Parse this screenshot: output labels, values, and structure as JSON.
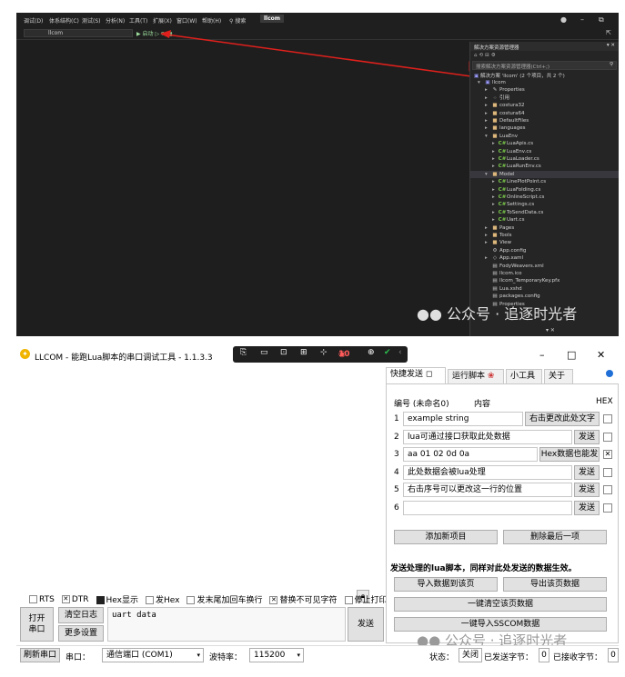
{
  "vs": {
    "menu": [
      "调试(D)",
      "体系结构(C)",
      "测试(S)",
      "分析(N)",
      "工具(T)",
      "扩展(X)",
      "窗口(W)",
      "帮助(H)",
      "搜索",
      "llcom"
    ],
    "search_label": "搜索",
    "project_badge": "llcom",
    "toolbar_combo": "llcom",
    "run_label": "启动",
    "solution_explorer": {
      "title": "解决方案资源管理器",
      "search_placeholder": "搜索解决方案资源管理器(Ctrl+;)",
      "solution_line": "解决方案 'llcom' (2 个项目，共 2 个)",
      "items": [
        {
          "label": "llcom",
          "level": 0,
          "icon": "project-icon",
          "arrow": "▾"
        },
        {
          "label": "Properties",
          "level": 1,
          "icon": "wrench-icon",
          "arrow": "▸"
        },
        {
          "label": "引用",
          "level": 1,
          "icon": "reference-icon",
          "arrow": "▸"
        },
        {
          "label": "costura32",
          "level": 1,
          "icon": "folder-icon",
          "arrow": "▸"
        },
        {
          "label": "costura64",
          "level": 1,
          "icon": "folder-icon",
          "arrow": "▸"
        },
        {
          "label": "DefaultFiles",
          "level": 1,
          "icon": "folder-icon",
          "arrow": "▸"
        },
        {
          "label": "languages",
          "level": 1,
          "icon": "folder-icon",
          "arrow": "▸"
        },
        {
          "label": "LuaEnv",
          "level": 1,
          "icon": "folder-icon",
          "arrow": "▾"
        },
        {
          "label": "LuaApis.cs",
          "level": 2,
          "icon": "cs-icon",
          "arrow": "▸"
        },
        {
          "label": "LuaEnv.cs",
          "level": 2,
          "icon": "cs-icon",
          "arrow": "▸"
        },
        {
          "label": "LuaLoader.cs",
          "level": 2,
          "icon": "cs-icon",
          "arrow": "▸"
        },
        {
          "label": "LuaRunEnv.cs",
          "level": 2,
          "icon": "cs-icon",
          "arrow": "▸"
        },
        {
          "label": "Model",
          "level": 1,
          "icon": "folder-icon",
          "arrow": "▾",
          "selected": true
        },
        {
          "label": "LinePlotPoint.cs",
          "level": 2,
          "icon": "cs-icon",
          "arrow": "▸"
        },
        {
          "label": "LuaFolding.cs",
          "level": 2,
          "icon": "cs-icon",
          "arrow": "▸"
        },
        {
          "label": "OnlineScript.cs",
          "level": 2,
          "icon": "cs-icon",
          "arrow": "▸"
        },
        {
          "label": "Settings.cs",
          "level": 2,
          "icon": "cs-icon",
          "arrow": "▸"
        },
        {
          "label": "ToSendData.cs",
          "level": 2,
          "icon": "cs-icon",
          "arrow": "▸"
        },
        {
          "label": "Uart.cs",
          "level": 2,
          "icon": "cs-icon",
          "arrow": "▸"
        },
        {
          "label": "Pages",
          "level": 1,
          "icon": "folder-icon",
          "arrow": "▸"
        },
        {
          "label": "Tools",
          "level": 1,
          "icon": "folder-icon",
          "arrow": "▸"
        },
        {
          "label": "View",
          "level": 1,
          "icon": "folder-icon",
          "arrow": "▸"
        },
        {
          "label": "App.config",
          "level": 1,
          "icon": "config-icon",
          "arrow": ""
        },
        {
          "label": "App.xaml",
          "level": 1,
          "icon": "xaml-icon",
          "arrow": "▸"
        },
        {
          "label": "FodyWeavers.xml",
          "level": 1,
          "icon": "file-icon",
          "arrow": ""
        },
        {
          "label": "llcom.ico",
          "level": 1,
          "icon": "file-icon",
          "arrow": ""
        },
        {
          "label": "llcom_TemporaryKey.pfx",
          "level": 1,
          "icon": "file-icon",
          "arrow": ""
        },
        {
          "label": "Lua.xshd",
          "level": 1,
          "icon": "file-icon",
          "arrow": ""
        },
        {
          "label": "packages.config",
          "level": 1,
          "icon": "file-icon",
          "arrow": ""
        },
        {
          "label": "Properties",
          "level": 1,
          "icon": "file-icon",
          "arrow": ""
        }
      ]
    },
    "watermark": "公众号 · 追逐时光者",
    "bottom_close": "▾ ✕"
  },
  "llcom": {
    "title": "LLCOM - 能跑Lua脚本的串口调试工具 - 1.1.3.3",
    "recording_label": "10",
    "options": [
      {
        "label": "RTS",
        "checked": false
      },
      {
        "label": "DTR",
        "checked": true
      },
      {
        "label": "Hex显示",
        "checked": false,
        "filled": true
      },
      {
        "label": "发Hex",
        "checked": false
      },
      {
        "label": "发末尾加回车换行",
        "checked": false
      },
      {
        "label": "替换不可见字符",
        "checked": true
      },
      {
        "label": "停止打印",
        "checked": false
      }
    ],
    "open_port_label": "打开\n串口",
    "open_port_line1": "打开",
    "open_port_line2": "串口",
    "clear_log_label": "清空日志",
    "more_settings_label": "更多设置",
    "send_input_value": "uart data",
    "send_label": "发送",
    "status": {
      "refresh_label": "刷新串口",
      "port_label": "串口：",
      "port_value": "通信端口 (COM1)",
      "baud_label": "波特率：",
      "baud_value": "115200",
      "state_label": "状态：",
      "state_value": "关闭",
      "sent_label": "已发送字节：",
      "sent_value": "0",
      "recv_label": "已接收字节：",
      "recv_value": "0"
    },
    "tabs": [
      "快捷发送",
      "运行脚本",
      "小工具",
      "关于"
    ],
    "quick_send": {
      "header_id": "编号 (未命名0)",
      "header_content": "内容",
      "header_hex": "HEX",
      "rows": [
        {
          "index": "1",
          "text": "example string",
          "button": "右击更改此处文字",
          "hex": false
        },
        {
          "index": "2",
          "text": "lua可通过接口获取此处数据",
          "button": "发送",
          "hex": false
        },
        {
          "index": "3",
          "text": "aa 01 02 0d 0a",
          "button": "Hex数据也能发",
          "hex": true
        },
        {
          "index": "4",
          "text": "此处数据会被lua处理",
          "button": "发送",
          "hex": false
        },
        {
          "index": "5",
          "text": "右击序号可以更改这一行的位置",
          "button": "发送",
          "hex": false
        },
        {
          "index": "6",
          "text": "",
          "button": "发送",
          "hex": false
        }
      ],
      "add_label": "添加新项目",
      "delete_last_label": "删除最后一项",
      "tip": "发送处理的lua脚本，同样对此处发送的数据生效。",
      "import_label": "导入数据到该页",
      "export_label": "导出该页数据",
      "clear_page_label": "一键清空该页数据",
      "import_sscom_label": "一键导入SSCOM数据"
    },
    "watermark": "公众号 · 追逐时光者"
  }
}
